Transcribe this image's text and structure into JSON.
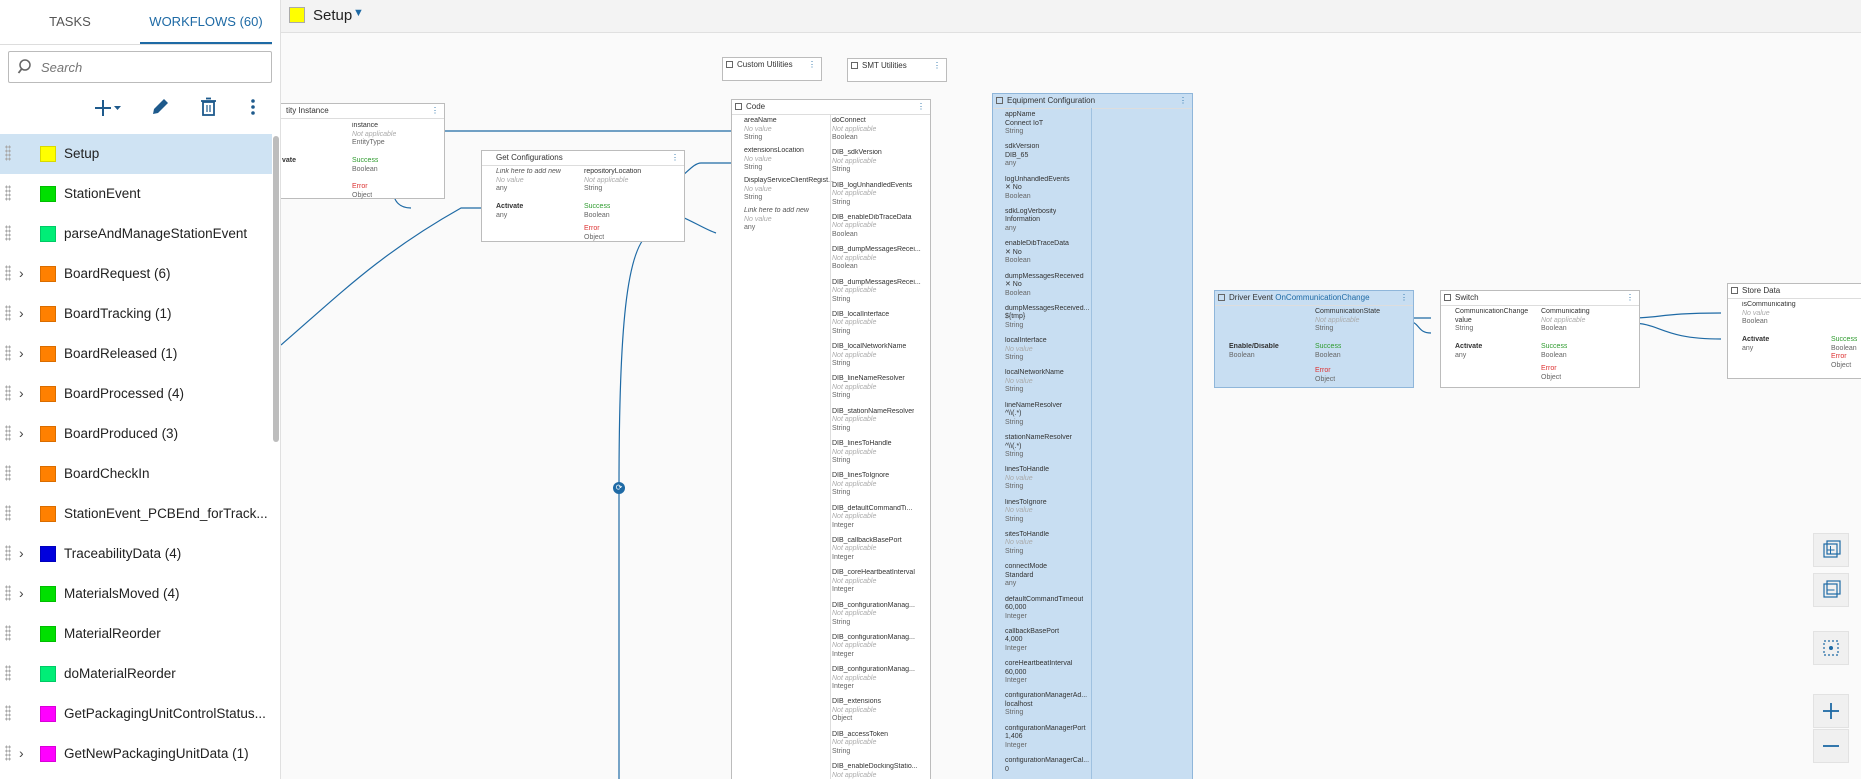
{
  "sidebar": {
    "tabs": [
      {
        "label": "TASKS"
      },
      {
        "label": "WORKFLOWS (60)"
      }
    ],
    "search_placeholder": "Search",
    "workflows": [
      {
        "label": "Setup",
        "color": "#ffff00",
        "expandable": false,
        "selected": true
      },
      {
        "label": "StationEvent",
        "color": "#00e000",
        "expandable": false
      },
      {
        "label": "parseAndManageStationEvent",
        "color": "#00ee77",
        "expandable": false
      },
      {
        "label": "BoardRequest  (6)",
        "color": "#ff8000",
        "expandable": true
      },
      {
        "label": "BoardTracking  (1)",
        "color": "#ff8000",
        "expandable": true
      },
      {
        "label": "BoardReleased  (1)",
        "color": "#ff8000",
        "expandable": true
      },
      {
        "label": "BoardProcessed  (4)",
        "color": "#ff8000",
        "expandable": true
      },
      {
        "label": "BoardProduced  (3)",
        "color": "#ff8000",
        "expandable": true
      },
      {
        "label": "BoardCheckIn",
        "color": "#ff8000",
        "expandable": false
      },
      {
        "label": "StationEvent_PCBEnd_forTrack...",
        "color": "#ff8000",
        "expandable": false
      },
      {
        "label": "TraceabilityData  (4)",
        "color": "#0000dd",
        "expandable": true
      },
      {
        "label": "MaterialsMoved  (4)",
        "color": "#00e000",
        "expandable": true
      },
      {
        "label": "MaterialReorder",
        "color": "#00e000",
        "expandable": false
      },
      {
        "label": "doMaterialReorder",
        "color": "#00ee77",
        "expandable": false
      },
      {
        "label": "GetPackagingUnitControlStatus...",
        "color": "#ff00ff",
        "expandable": false
      },
      {
        "label": "GetNewPackagingUnitData  (1)",
        "color": "#ff00ff",
        "expandable": true
      }
    ]
  },
  "header": {
    "title": "Setup",
    "color": "#ffff00"
  },
  "nodes": {
    "entity": {
      "title": "tity Instance",
      "in_instance": "instance",
      "in_instance_v": "Not applicable",
      "in_instance_t": "EntityType",
      "in_act": "vate",
      "success": "Success",
      "success_t": "Boolean",
      "error": "Error",
      "error_t": "Object"
    },
    "getconfig": {
      "title": "Get Configurations",
      "link": "Link here to add new",
      "link_v": "No value",
      "link_t": "any",
      "out1": "repositoryLocation",
      "out1_v": "Not applicable",
      "out1_t": "String",
      "act": "Activate",
      "act_t": "any",
      "success": "Success",
      "success_t": "Boolean",
      "error": "Error",
      "error_t": "Object"
    },
    "custom": {
      "title": "Custom Utilities"
    },
    "smt": {
      "title": "SMT Utilities"
    },
    "code": {
      "title": "Code",
      "inputs": [
        {
          "n": "areaName",
          "v": "No value",
          "t": "String"
        },
        {
          "n": "extensionsLocation",
          "v": "No value",
          "t": "String"
        },
        {
          "n": "DisplayServiceClientRegist...",
          "v": "No value",
          "t": "String"
        },
        {
          "n": "Link here to add new",
          "v": "No value",
          "t": "any"
        }
      ],
      "outputs": [
        {
          "n": "doConnect",
          "v": "Not applicable",
          "t": "Boolean"
        },
        {
          "n": "DIB_sdkVersion",
          "v": "Not applicable",
          "t": "String"
        },
        {
          "n": "DIB_logUnhandledEvents",
          "v": "Not applicable",
          "t": "String"
        },
        {
          "n": "DIB_enableDibTraceData",
          "v": "Not applicable",
          "t": "Boolean"
        },
        {
          "n": "DIB_dumpMessagesRecei...",
          "v": "Not applicable",
          "t": "Boolean"
        },
        {
          "n": "DIB_dumpMessagesRecei...",
          "v": "Not applicable",
          "t": "String"
        },
        {
          "n": "DIB_localInterface",
          "v": "Not applicable",
          "t": "String"
        },
        {
          "n": "DIB_localNetworkName",
          "v": "Not applicable",
          "t": "String"
        },
        {
          "n": "DIB_lineNameResolver",
          "v": "Not applicable",
          "t": "String"
        },
        {
          "n": "DIB_stationNameResolver",
          "v": "Not applicable",
          "t": "String"
        },
        {
          "n": "DIB_linesToHandle",
          "v": "Not applicable",
          "t": "String"
        },
        {
          "n": "DIB_linesToIgnore",
          "v": "Not applicable",
          "t": "String"
        },
        {
          "n": "DIB_defaultCommandTi...",
          "v": "Not applicable",
          "t": "Integer"
        },
        {
          "n": "DIB_callbackBasePort",
          "v": "Not applicable",
          "t": "Integer"
        },
        {
          "n": "DIB_coreHeartbeatInterval",
          "v": "Not applicable",
          "t": "Integer"
        },
        {
          "n": "DIB_configurationManag...",
          "v": "Not applicable",
          "t": "String"
        },
        {
          "n": "DIB_configurationManag...",
          "v": "Not applicable",
          "t": "Integer"
        },
        {
          "n": "DIB_configurationManag...",
          "v": "Not applicable",
          "t": "Integer"
        },
        {
          "n": "DIB_extensions",
          "v": "Not applicable",
          "t": "Object"
        },
        {
          "n": "DIB_accessToken",
          "v": "Not applicable",
          "t": "String"
        },
        {
          "n": "DIB_enableDockingStatio...",
          "v": "Not applicable",
          "t": ""
        }
      ]
    },
    "equip": {
      "title": "Equipment Configuration",
      "inputs": [
        {
          "n": "appName",
          "v": "Connect IoT",
          "t": "String",
          "novalue": false
        },
        {
          "n": "sdkVersion",
          "v": "DIB_65",
          "t": "any",
          "novalue": false
        },
        {
          "n": "logUnhandledEvents",
          "v": "✕ No",
          "t": "Boolean",
          "novalue": false
        },
        {
          "n": "sdkLogVerbosity",
          "v": "Information",
          "t": "any",
          "novalue": false
        },
        {
          "n": "enableDibTraceData",
          "v": "✕ No",
          "t": "Boolean",
          "novalue": false
        },
        {
          "n": "dumpMessagesReceived",
          "v": "✕ No",
          "t": "Boolean",
          "novalue": false
        },
        {
          "n": "dumpMessagesReceived...",
          "v": "${tmp}",
          "t": "String",
          "novalue": false
        },
        {
          "n": "localInterface",
          "v": "No value",
          "t": "String",
          "novalue": true
        },
        {
          "n": "localNetworkName",
          "v": "No value",
          "t": "String",
          "novalue": true
        },
        {
          "n": "lineNameResolver",
          "v": "^\\\\(.*)",
          "t": "String",
          "novalue": false
        },
        {
          "n": "stationNameResolver",
          "v": "^\\\\(.*)",
          "t": "String",
          "novalue": false
        },
        {
          "n": "linesToHandle",
          "v": "No value",
          "t": "String",
          "novalue": true
        },
        {
          "n": "linesToIgnore",
          "v": "No value",
          "t": "String",
          "novalue": true
        },
        {
          "n": "sitesToHandle",
          "v": "No value",
          "t": "String",
          "novalue": true
        },
        {
          "n": "connectMode",
          "v": "Standard",
          "t": "any",
          "novalue": false
        },
        {
          "n": "defaultCommandTimeout",
          "v": "60,000",
          "t": "Integer",
          "novalue": false
        },
        {
          "n": "callbackBasePort",
          "v": "4,000",
          "t": "Integer",
          "novalue": false
        },
        {
          "n": "coreHeartbeatInterval",
          "v": "60,000",
          "t": "Integer",
          "novalue": false
        },
        {
          "n": "configurationManagerAd...",
          "v": "localhost",
          "t": "String",
          "novalue": false
        },
        {
          "n": "configurationManagerPort",
          "v": "1,406",
          "t": "Integer",
          "novalue": false
        },
        {
          "n": "configurationManagerCal...",
          "v": "0",
          "t": "",
          "novalue": false
        }
      ]
    },
    "driver": {
      "title": "Driver Event",
      "subtitle": "OnCommunicationChange",
      "out1": "CommunicationState",
      "out1_v": "Not applicable",
      "out1_t": "String",
      "in1": "Enable/Disable",
      "in1_t": "Boolean",
      "success": "Success",
      "success_t": "Boolean",
      "error": "Error",
      "error_t": "Object"
    },
    "switch": {
      "title": "Switch",
      "in1": "CommunicationChange",
      "in1b": "value",
      "in1_t": "String",
      "out1": "Communicating",
      "out1_v": "Not applicable",
      "out1_t": "Boolean",
      "act": "Activate",
      "act_t": "any",
      "success": "Success",
      "success_t": "Boolean",
      "error": "Error",
      "error_t": "Object"
    },
    "store": {
      "title": "Store Data",
      "in1": "isCommunicating",
      "in1_v": "No value",
      "in1_t": "Boolean",
      "act": "Activate",
      "act_t": "any",
      "success": "Success",
      "success_t": "Boolean",
      "error": "Error",
      "error_t": "Object"
    }
  }
}
